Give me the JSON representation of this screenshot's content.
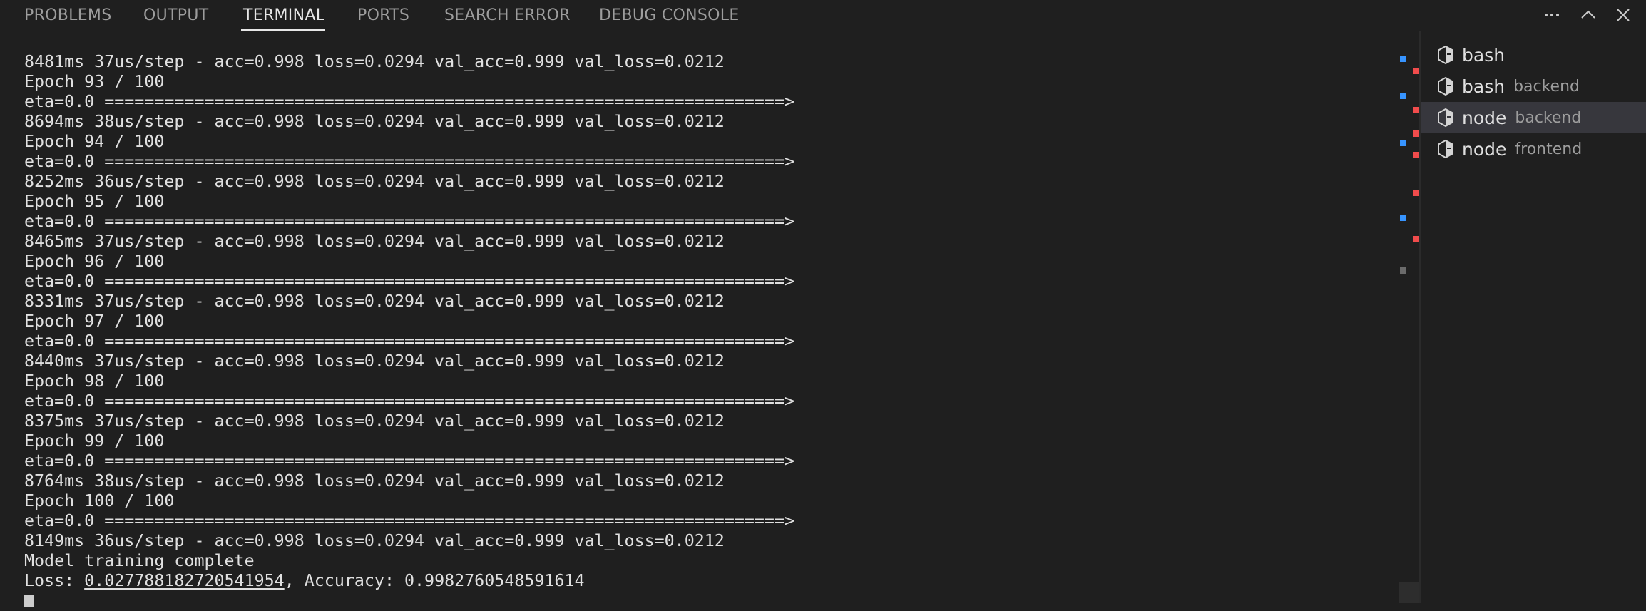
{
  "panel": {
    "tabs": [
      {
        "label": "PROBLEMS"
      },
      {
        "label": "OUTPUT"
      },
      {
        "label": "TERMINAL"
      },
      {
        "label": "PORTS"
      },
      {
        "label": "SEARCH ERROR"
      },
      {
        "label": "DEBUG CONSOLE"
      }
    ],
    "active_tab": "TERMINAL",
    "actions": [
      {
        "icon": "ellipsis-icon"
      },
      {
        "icon": "chevron-up-icon"
      },
      {
        "icon": "close-icon"
      }
    ]
  },
  "terminal": {
    "lines": [
      "8481ms 37us/step - acc=0.998 loss=0.0294 val_acc=0.999 val_loss=0.0212",
      "Epoch 93 / 100",
      "eta=0.0 ====================================================================>",
      "8694ms 38us/step - acc=0.998 loss=0.0294 val_acc=0.999 val_loss=0.0212",
      "Epoch 94 / 100",
      "eta=0.0 ====================================================================>",
      "8252ms 36us/step - acc=0.998 loss=0.0294 val_acc=0.999 val_loss=0.0212",
      "Epoch 95 / 100",
      "eta=0.0 ====================================================================>",
      "8465ms 37us/step - acc=0.998 loss=0.0294 val_acc=0.999 val_loss=0.0212",
      "Epoch 96 / 100",
      "eta=0.0 ====================================================================>",
      "8331ms 37us/step - acc=0.998 loss=0.0294 val_acc=0.999 val_loss=0.0212",
      "Epoch 97 / 100",
      "eta=0.0 ====================================================================>",
      "8440ms 37us/step - acc=0.998 loss=0.0294 val_acc=0.999 val_loss=0.0212",
      "Epoch 98 / 100",
      "eta=0.0 ====================================================================>",
      "8375ms 37us/step - acc=0.998 loss=0.0294 val_acc=0.999 val_loss=0.0212",
      "Epoch 99 / 100",
      "eta=0.0 ====================================================================>",
      "8764ms 38us/step - acc=0.998 loss=0.0294 val_acc=0.999 val_loss=0.0212",
      "Epoch 100 / 100",
      "eta=0.0 ====================================================================>",
      "8149ms 36us/step - acc=0.998 loss=0.0294 val_acc=0.999 val_loss=0.0212",
      "Model training complete"
    ],
    "final_line": {
      "prefix": "Loss: ",
      "loss_value": "0.027788182720541954",
      "middle": ", Accuracy: ",
      "accuracy_value": "0.9982760548591614"
    }
  },
  "terminal_list": [
    {
      "name": "bash",
      "desc": "",
      "selected": false
    },
    {
      "name": "bash",
      "desc": "backend",
      "selected": false
    },
    {
      "name": "node",
      "desc": "backend",
      "selected": true
    },
    {
      "name": "node",
      "desc": "frontend",
      "selected": false
    }
  ],
  "colors": {
    "background": "#1f1f1f",
    "selected_item": "#37373d",
    "mark_blue": "#3794ff",
    "mark_red": "#f14c4c",
    "mark_gray": "#6b6b6b"
  }
}
